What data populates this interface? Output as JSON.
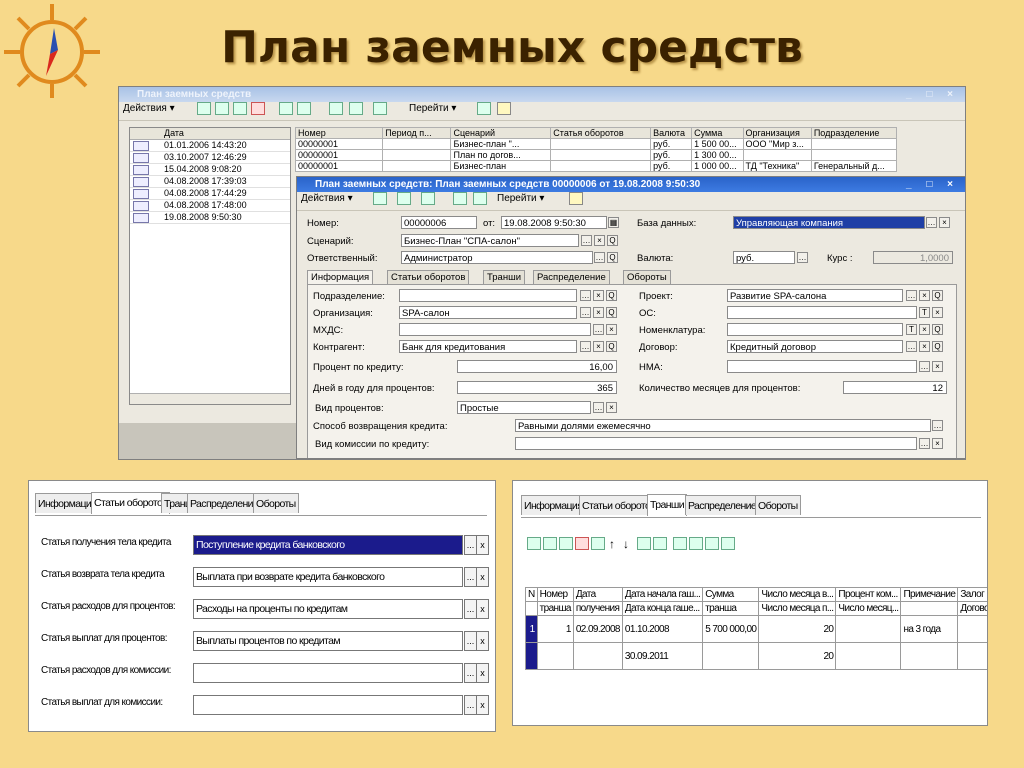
{
  "slide": {
    "title": "План заемных средств"
  },
  "list_window": {
    "title": "План заемных средств",
    "actions_label": "Действия ▾",
    "goto_label": "Перейти ▾",
    "left_col_header": "Дата",
    "left_rows": [
      "01.01.2006 14:43:20",
      "03.10.2007 12:46:29",
      "15.04.2008 9:08:20",
      "04.08.2008 17:39:03",
      "04.08.2008 17:44:29",
      "04.08.2008 17:48:00",
      "19.08.2008 9:50:30"
    ],
    "columns": [
      "Номер",
      "Период п...",
      "Сценарий",
      "Статья оборотов",
      "Валюта",
      "Сумма",
      "Организация",
      "Подразделение"
    ],
    "rows": [
      [
        "00000001",
        "",
        "Бизнес-план \"...",
        "",
        "руб.",
        "1 500 00...",
        "ООО \"Мир з...",
        ""
      ],
      [
        "00000001",
        "",
        "План по догов...",
        "",
        "руб.",
        "1 300 00...",
        "",
        ""
      ],
      [
        "00000001",
        "",
        "Бизнес-план",
        "",
        "руб.",
        "1 000 00...",
        "ТД \"Техника\"",
        "Генеральный д..."
      ]
    ]
  },
  "doc_window": {
    "title": "План заемных средств: План заемных средств 00000006     от 19.08.2008 9:50:30",
    "actions_label": "Действия ▾",
    "goto_label": "Перейти ▾",
    "number_label": "Номер:",
    "number_value": "00000006",
    "date_label": "от:",
    "date_value": "19.08.2008  9:50:30",
    "db_label": "База данных:",
    "db_value": "Управляющая компания",
    "scenario_label": "Сценарий:",
    "scenario_value": "Бизнес-План \"СПА-салон\"",
    "responsible_label": "Ответственный:",
    "responsible_value": "Администратор",
    "currency_label": "Валюта:",
    "currency_value": "руб.",
    "rate_label": "Курс :",
    "rate_value": "1,0000",
    "tabs": [
      "Информация",
      "Статьи оборотов",
      "Транши",
      "Распределение",
      "Обороты"
    ],
    "division_label": "Подразделение:",
    "division_value": "",
    "project_label": "Проект:",
    "project_value": "Развитие SPA-салона",
    "org_label": "Организация:",
    "org_value": "SPA-салон",
    "os_label": "ОС:",
    "os_value": "",
    "mkhds_label": "МХДС:",
    "mkhds_value": "",
    "nomen_label": "Номенклатура:",
    "nomen_value": "",
    "contractor_label": "Контрагент:",
    "contractor_value": "Банк для кредитования",
    "contract_label": "Договор:",
    "contract_value": "Кредитный договор",
    "percent_label": "Процент по кредиту:",
    "percent_value": "16,00",
    "nma_label": "НМА:",
    "nma_value": "",
    "days_label": "Дней в году для процентов:",
    "days_value": "365",
    "months_label": "Количество месяцев для процентов:",
    "months_value": "12",
    "pct_type_label": "Вид процентов:",
    "pct_type_value": "Простые",
    "return_label": "Способ возвращения кредита:",
    "return_value": "Равными долями ежемесячно",
    "commission_label": "Вид комиссии по кредиту:",
    "commission_value": ""
  },
  "panel_left": {
    "tabs": [
      "Информация",
      "Статьи оборотов",
      "Транши",
      "Распределение",
      "Обороты"
    ],
    "rows": [
      {
        "label": "Статья получения тела кредита",
        "value": "Поступление кредита банковского"
      },
      {
        "label": "Статья возврата тела кредита",
        "value": "Выплата при возврате кредита банковского"
      },
      {
        "label": "Статья расходов для процентов:",
        "value": "Расходы на проценты по кредитам"
      },
      {
        "label": "Статья выплат для процентов:",
        "value": "Выплаты процентов по кредитам"
      },
      {
        "label": "Статья расходов для комиссии:",
        "value": ""
      },
      {
        "label": "Статья выплат для комиссии:",
        "value": ""
      }
    ],
    "btn_more": "...",
    "btn_clear": "x"
  },
  "panel_right": {
    "tabs": [
      "Информация",
      "Статьи оборотов",
      "Транши",
      "Распределение",
      "Обороты"
    ],
    "header1": [
      "N",
      "Номер",
      "Дата",
      "Дата начала гаш...",
      "Сумма",
      "Число месяца в...",
      "Процент ком...",
      "Примечание",
      "Залог"
    ],
    "header2": [
      "",
      "транша",
      "получения",
      "Дата конца гаше...",
      "транша",
      "Число месяца п...",
      "Число месяц...",
      "",
      "Договор за"
    ],
    "row1": [
      "1",
      "1",
      "02.09.2008",
      "01.10.2008",
      "5 700 000,00",
      "20",
      "",
      "на 3 года",
      ""
    ],
    "row2": [
      "",
      "",
      "",
      "30.09.2011",
      "",
      "20",
      "",
      "",
      ""
    ]
  }
}
